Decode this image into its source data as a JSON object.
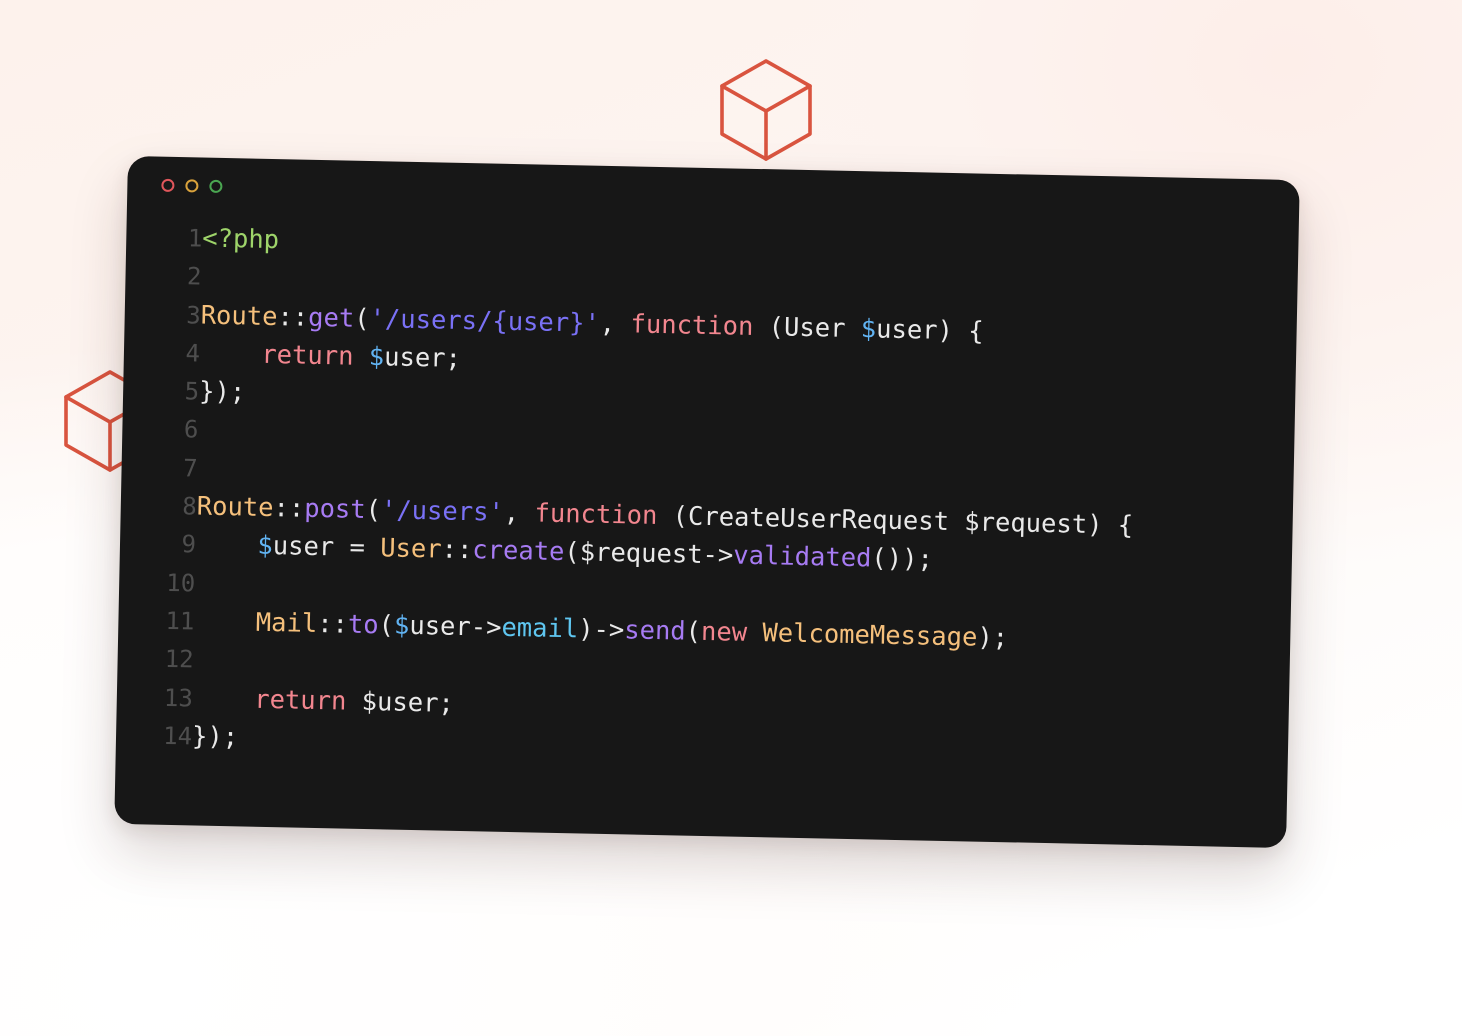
{
  "background": {
    "gradient_from": "#fdf2ec",
    "gradient_to": "#ffffff"
  },
  "decorations": {
    "cube_color": "#d9543f",
    "cubes": [
      {
        "name": "cube-top",
        "label": "wireframe-cube"
      },
      {
        "name": "cube-left",
        "label": "wireframe-cube"
      }
    ]
  },
  "window": {
    "background": "#171717",
    "traffic_lights": [
      {
        "name": "close",
        "color": "#e0565b"
      },
      {
        "name": "minimize",
        "color": "#d9a23c"
      },
      {
        "name": "maximize",
        "color": "#4aa651"
      }
    ]
  },
  "editor": {
    "language": "php",
    "font_size": "25.5px",
    "line_count": 14,
    "line_numbers": [
      "1",
      "2",
      "3",
      "4",
      "5",
      "6",
      "7",
      "8",
      "9",
      "10",
      "11",
      "12",
      "13",
      "14"
    ],
    "lines": [
      {
        "number": "1",
        "text": "<?php",
        "tokens": [
          {
            "t": "<?php",
            "c": "t-tag"
          }
        ]
      },
      {
        "number": "2",
        "text": "",
        "tokens": []
      },
      {
        "number": "3",
        "text": "Route::get('/users/{user}', function (User $user) {",
        "tokens": [
          {
            "t": "Route",
            "c": "t-class"
          },
          {
            "t": "::",
            "c": "t-plain"
          },
          {
            "t": "get",
            "c": "t-method"
          },
          {
            "t": "(",
            "c": "t-plain"
          },
          {
            "t": "'/users/{user}'",
            "c": "t-string"
          },
          {
            "t": ", ",
            "c": "t-plain"
          },
          {
            "t": "function",
            "c": "t-kw"
          },
          {
            "t": " (User ",
            "c": "t-plain"
          },
          {
            "t": "$",
            "c": "t-var"
          },
          {
            "t": "user) {",
            "c": "t-plain"
          }
        ]
      },
      {
        "number": "4",
        "text": "    return $user;",
        "tokens": [
          {
            "t": "    ",
            "c": "t-plain"
          },
          {
            "t": "return",
            "c": "t-kw"
          },
          {
            "t": " ",
            "c": "t-plain"
          },
          {
            "t": "$",
            "c": "t-var"
          },
          {
            "t": "user;",
            "c": "t-plain"
          }
        ]
      },
      {
        "number": "5",
        "text": "});",
        "tokens": [
          {
            "t": "});",
            "c": "t-plain"
          }
        ]
      },
      {
        "number": "6",
        "text": "",
        "tokens": []
      },
      {
        "number": "7",
        "text": "",
        "tokens": []
      },
      {
        "number": "8",
        "text": "Route::post('/users', function (CreateUserRequest $request) {",
        "tokens": [
          {
            "t": "Route",
            "c": "t-class"
          },
          {
            "t": "::",
            "c": "t-plain"
          },
          {
            "t": "post",
            "c": "t-method"
          },
          {
            "t": "(",
            "c": "t-plain"
          },
          {
            "t": "'/users'",
            "c": "t-string"
          },
          {
            "t": ", ",
            "c": "t-plain"
          },
          {
            "t": "function",
            "c": "t-kw"
          },
          {
            "t": " (CreateUserRequest $request) {",
            "c": "t-plain"
          }
        ]
      },
      {
        "number": "9",
        "text": "    $user = User::create($request->validated());",
        "tokens": [
          {
            "t": "    ",
            "c": "t-plain"
          },
          {
            "t": "$",
            "c": "t-var"
          },
          {
            "t": "user = ",
            "c": "t-plain"
          },
          {
            "t": "User",
            "c": "t-class"
          },
          {
            "t": "::",
            "c": "t-plain"
          },
          {
            "t": "create",
            "c": "t-method"
          },
          {
            "t": "($request->",
            "c": "t-plain"
          },
          {
            "t": "validated",
            "c": "t-method"
          },
          {
            "t": "());",
            "c": "t-plain"
          }
        ]
      },
      {
        "number": "10",
        "text": "",
        "tokens": []
      },
      {
        "number": "11",
        "text": "    Mail::to($user->email)->send(new WelcomeMessage);",
        "tokens": [
          {
            "t": "    ",
            "c": "t-plain"
          },
          {
            "t": "Mail",
            "c": "t-class"
          },
          {
            "t": "::",
            "c": "t-plain"
          },
          {
            "t": "to",
            "c": "t-method"
          },
          {
            "t": "(",
            "c": "t-plain"
          },
          {
            "t": "$",
            "c": "t-var"
          },
          {
            "t": "user->",
            "c": "t-plain"
          },
          {
            "t": "email",
            "c": "t-prop"
          },
          {
            "t": ")->",
            "c": "t-plain"
          },
          {
            "t": "send",
            "c": "t-method"
          },
          {
            "t": "(",
            "c": "t-plain"
          },
          {
            "t": "new",
            "c": "t-kw"
          },
          {
            "t": " WelcomeMessage",
            "c": "t-class"
          },
          {
            "t": ");",
            "c": "t-plain"
          }
        ]
      },
      {
        "number": "12",
        "text": "",
        "tokens": []
      },
      {
        "number": "13",
        "text": "    return $user;",
        "tokens": [
          {
            "t": "    ",
            "c": "t-plain"
          },
          {
            "t": "return",
            "c": "t-kw"
          },
          {
            "t": " $user;",
            "c": "t-plain"
          }
        ]
      },
      {
        "number": "14",
        "text": "});",
        "tokens": [
          {
            "t": "});",
            "c": "t-plain"
          }
        ]
      }
    ]
  }
}
